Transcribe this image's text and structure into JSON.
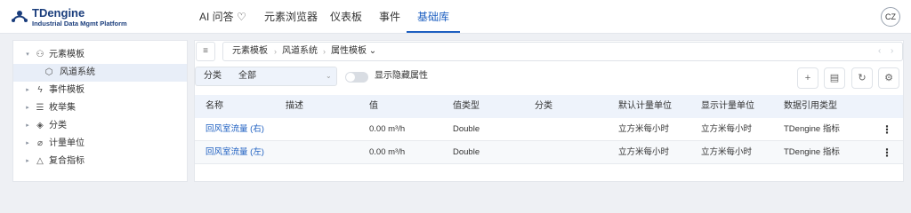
{
  "header": {
    "logo_title": "TDengine",
    "logo_subtitle": "Industrial Data Mgmt Platform",
    "nav": [
      {
        "label": "AI 问答 ♡"
      },
      {
        "label": "元素浏览器"
      },
      {
        "label": "仪表板"
      },
      {
        "label": "事件"
      },
      {
        "label": "基础库"
      }
    ],
    "active_nav": "基础库",
    "avatar": "CZ"
  },
  "sidebar": {
    "items": [
      {
        "label": "元素模板",
        "icon": "template-icon",
        "expanded": true
      },
      {
        "label": "风道系统",
        "icon": "cube-icon",
        "selected": true
      },
      {
        "label": "事件模板",
        "icon": "lightning-icon"
      },
      {
        "label": "枚举集",
        "icon": "list-icon"
      },
      {
        "label": "分类",
        "icon": "tag-icon"
      },
      {
        "label": "计量单位",
        "icon": "ruler-icon"
      },
      {
        "label": "复合指标",
        "icon": "warning-triangle-icon"
      }
    ]
  },
  "breadcrumb": {
    "items": [
      "元素模板",
      "风道系统",
      "属性模板 ⌄"
    ]
  },
  "filter": {
    "label": "分类",
    "value": "全部"
  },
  "toggle": {
    "label": "显示隐藏属性",
    "on": false
  },
  "table": {
    "columns": [
      "名称",
      "描述",
      "值",
      "值类型",
      "分类",
      "默认计量单位",
      "显示计量单位",
      "数据引用类型"
    ],
    "rows": [
      {
        "name": "回风室流量 (右)",
        "desc": "",
        "value": "0.00 m³/h",
        "type": "Double",
        "category": "",
        "default_unit": "立方米每小时",
        "display_unit": "立方米每小时",
        "ref_type": "TDengine 指标"
      },
      {
        "name": "回风室流量 (左)",
        "desc": "",
        "value": "0.00 m³/h",
        "type": "Double",
        "category": "",
        "default_unit": "立方米每小时",
        "display_unit": "立方米每小时",
        "ref_type": "TDengine 指标"
      }
    ]
  },
  "colors": {
    "accent": "#1d5fc1",
    "brand": "#1a3d7c"
  }
}
